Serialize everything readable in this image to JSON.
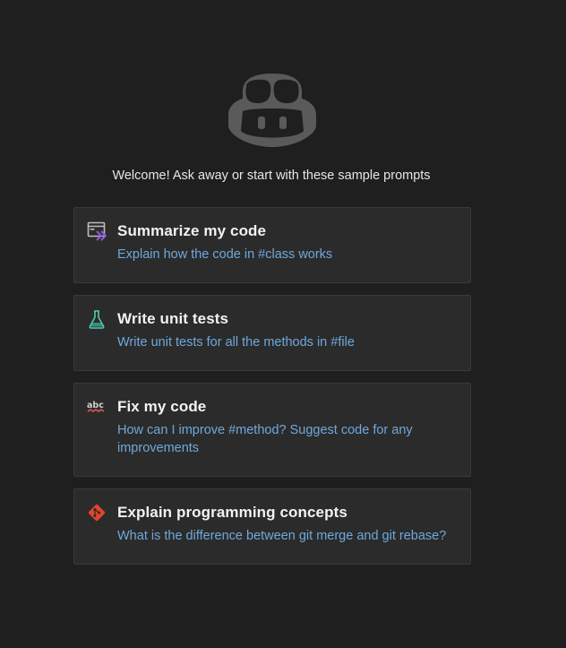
{
  "welcome_text": "Welcome! Ask away or start with these sample prompts",
  "prompts": [
    {
      "icon": "code-file-icon",
      "title": "Summarize my code",
      "description": "Explain how the code in #class works"
    },
    {
      "icon": "flask-icon",
      "title": "Write unit tests",
      "description": "Write unit tests for all the methods in #file"
    },
    {
      "icon": "spellcheck-icon",
      "title": "Fix my code",
      "description": "How can I improve #method? Suggest code for any improvements"
    },
    {
      "icon": "git-icon",
      "title": "Explain programming concepts",
      "description": "What is the difference between git merge and git rebase?"
    }
  ],
  "colors": {
    "background": "#1f1f1f",
    "card_background": "#2b2b2b",
    "card_border": "#3a3a3a",
    "title_text": "#f2f2f2",
    "description_text": "#6fa8dc",
    "logo": "#5a5a5a",
    "git_icon": "#e0442b",
    "flask_icon": "#4ec9b0",
    "code_icon_accent": "#8a5cd6"
  }
}
